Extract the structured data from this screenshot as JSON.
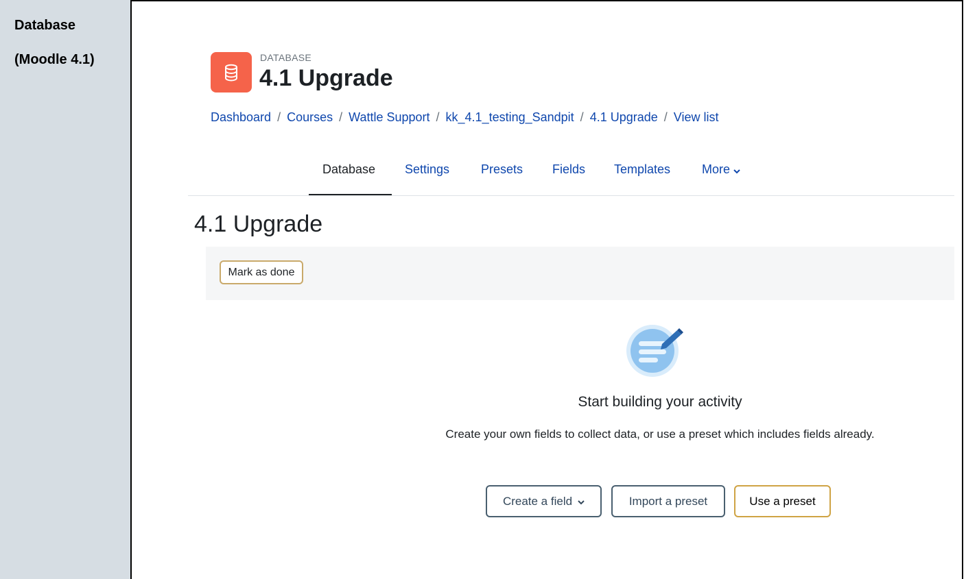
{
  "left_cell": {
    "title": "Database",
    "subtitle": "(Moodle 4.1)"
  },
  "activity": {
    "kind": "DATABASE",
    "title": "4.1 Upgrade",
    "icon": "database-icon",
    "icon_color": "#f5634a"
  },
  "breadcrumb": {
    "items": [
      "Dashboard",
      "Courses",
      "Wattle Support",
      "kk_4.1_testing_Sandpit",
      "4.1 Upgrade",
      "View list"
    ],
    "separator": "/"
  },
  "tabs": {
    "items": [
      "Database",
      "Settings",
      "Presets",
      "Fields",
      "Templates",
      "More"
    ],
    "active": "Database",
    "more_icon": "chevron-down-icon"
  },
  "page_heading": "4.1 Upgrade",
  "completion": {
    "mark_done_label": "Mark as done"
  },
  "empty_state": {
    "icon": "document-edit-icon",
    "title": "Start building your activity",
    "description": "Create your own fields to collect data, or use a preset which includes fields already."
  },
  "actions": {
    "create_field_label": "Create a field",
    "import_preset_label": "Import a preset",
    "use_preset_label": "Use a preset"
  },
  "colors": {
    "link": "#0f47ad",
    "text": "#1d2125",
    "left_cell_bg": "#d6dde3",
    "primary_border": "#cfa344",
    "outline_border": "#495f6f"
  }
}
